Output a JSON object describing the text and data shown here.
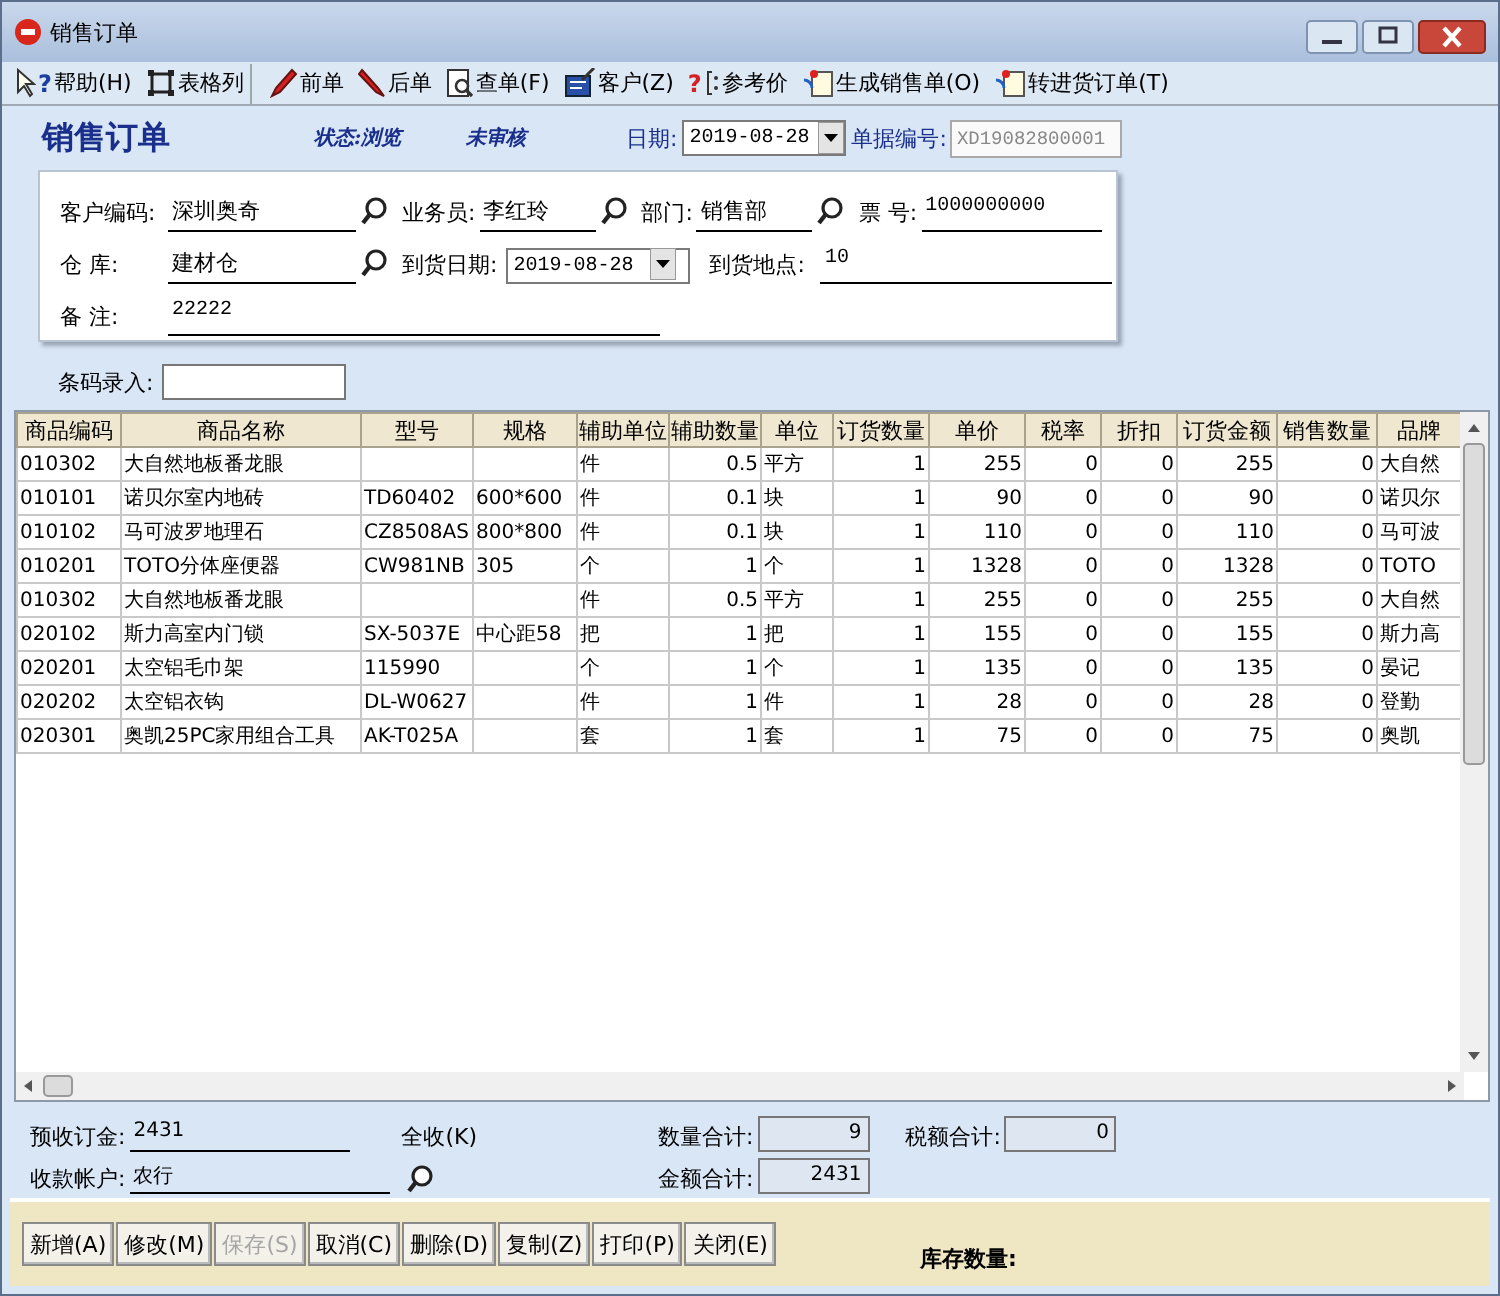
{
  "window": {
    "title": "销售订单"
  },
  "toolbar": [
    {
      "label": "帮助(H)",
      "glyph": "?"
    },
    {
      "label": "表格列"
    },
    {
      "label": "前单"
    },
    {
      "label": "后单"
    },
    {
      "label": "查单(F)"
    },
    {
      "label": "客户(Z)"
    },
    {
      "label": "参考价",
      "glyph": "?"
    },
    {
      "label": "生成销售单(O)"
    },
    {
      "label": "转进货订单(T)"
    }
  ],
  "header": {
    "title": "销售订单",
    "status": "状态:浏览",
    "audit": "未审核",
    "date_label": "日期:",
    "date": "2019-08-28",
    "doc_no_label": "单据编号:",
    "doc_no": "XD19082800001"
  },
  "form": {
    "rows": [
      [
        {
          "label": "客户编码:",
          "value": "深圳奥奇",
          "kind": "lookup"
        },
        {
          "label": "业务员:",
          "value": "李红玲",
          "kind": "lookup"
        },
        {
          "label": "部门:",
          "value": "销售部",
          "kind": "lookup"
        },
        {
          "label": "票 号:",
          "value": "1000000000",
          "kind": "text"
        }
      ],
      [
        {
          "label": "仓 库:",
          "value": "建材仓",
          "kind": "lookup"
        },
        {
          "label": "到货日期:",
          "value": "2019-08-28",
          "kind": "date"
        },
        {
          "label": "到货地点:",
          "value": "10",
          "kind": "text"
        }
      ],
      [
        {
          "label": "备 注:",
          "value": "22222",
          "kind": "wide"
        }
      ]
    ]
  },
  "barcode": {
    "label": "条码录入:"
  },
  "table": {
    "columns": [
      "商品编码",
      "商品名称",
      "型号",
      "规格",
      "辅助单位",
      "辅助数量",
      "单位",
      "订货数量",
      "单价",
      "税率",
      "折扣",
      "订货金额",
      "销售数量",
      "品牌"
    ],
    "rows": [
      [
        "010302",
        "大自然地板番龙眼",
        "",
        "",
        "件",
        "0.5",
        "平方",
        "1",
        "255",
        "0",
        "0",
        "255",
        "0",
        "大自然"
      ],
      [
        "010101",
        "诺贝尔室内地砖",
        "TD60402",
        "600*600",
        "件",
        "0.1",
        "块",
        "1",
        "90",
        "0",
        "0",
        "90",
        "0",
        "诺贝尔"
      ],
      [
        "010102",
        "马可波罗地理石",
        "CZ8508AS",
        "800*800",
        "件",
        "0.1",
        "块",
        "1",
        "110",
        "0",
        "0",
        "110",
        "0",
        "马可波"
      ],
      [
        "010201",
        "TOTO分体座便器",
        "CW981NB",
        "305",
        "个",
        "1",
        "个",
        "1",
        "1328",
        "0",
        "0",
        "1328",
        "0",
        "TOTO"
      ],
      [
        "010302",
        "大自然地板番龙眼",
        "",
        "",
        "件",
        "0.5",
        "平方",
        "1",
        "255",
        "0",
        "0",
        "255",
        "0",
        "大自然"
      ],
      [
        "020102",
        "斯力高室内门锁",
        "SX-5037E",
        "中心距58",
        "把",
        "1",
        "把",
        "1",
        "155",
        "0",
        "0",
        "155",
        "0",
        "斯力高"
      ],
      [
        "020201",
        "太空铝毛巾架",
        "115990",
        "",
        "个",
        "1",
        "个",
        "1",
        "135",
        "0",
        "0",
        "135",
        "0",
        "晏记"
      ],
      [
        "020202",
        "太空铝衣钩",
        "DL-W0627",
        "",
        "件",
        "1",
        "件",
        "1",
        "28",
        "0",
        "0",
        "28",
        "0",
        "登勤"
      ],
      [
        "020301",
        "奥凯25PC家用组合工具",
        "AK-T025A",
        "",
        "套",
        "1",
        "套",
        "1",
        "75",
        "0",
        "0",
        "75",
        "0",
        "奥凯"
      ]
    ]
  },
  "summary": {
    "deposit_label": "预收订金:",
    "deposit": "2431",
    "full_receive": "全收(K)",
    "account_label": "收款帐户:",
    "account": "农行",
    "qty_label": "数量合计:",
    "qty": "9",
    "tax_label": "税额合计:",
    "tax": "0",
    "amount_label": "金额合计:",
    "amount": "2431"
  },
  "buttons": [
    {
      "label": "新增(A)",
      "disabled": false
    },
    {
      "label": "修改(M)",
      "disabled": false
    },
    {
      "label": "保存(S)",
      "disabled": true
    },
    {
      "label": "取消(C)",
      "disabled": false
    },
    {
      "label": "删除(D)",
      "disabled": false
    },
    {
      "label": "复制(Z)",
      "disabled": false
    },
    {
      "label": "打印(P)",
      "disabled": false
    },
    {
      "label": "关闭(E)",
      "disabled": false
    }
  ],
  "stock_label": "库存数量:"
}
